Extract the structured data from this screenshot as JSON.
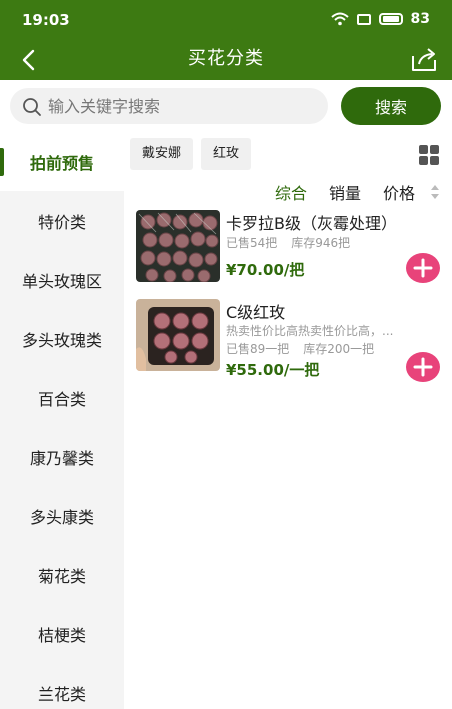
{
  "status_bar": {
    "time": "19:03",
    "battery": "83"
  },
  "nav": {
    "title": "买花分类"
  },
  "search": {
    "placeholder": "输入关键字搜索",
    "button": "搜索"
  },
  "sidebar": {
    "items": [
      {
        "label": "拍前预售",
        "active": true
      },
      {
        "label": "特价类"
      },
      {
        "label": "单头玫瑰区"
      },
      {
        "label": "多头玫瑰类"
      },
      {
        "label": "百合类"
      },
      {
        "label": "康乃馨类"
      },
      {
        "label": "多头康类"
      },
      {
        "label": "菊花类"
      },
      {
        "label": "桔梗类"
      },
      {
        "label": "兰花类"
      }
    ]
  },
  "tags": [
    "戴安娜",
    "红玫"
  ],
  "sort": {
    "items": [
      "综合",
      "销量",
      "价格"
    ],
    "active": "综合"
  },
  "products": [
    {
      "name": "卡罗拉B级（灰霉处理）",
      "desc": "",
      "sold": "已售54把",
      "stock": "库存946把",
      "price": "¥70.00/把"
    },
    {
      "name": "C级红玫",
      "desc": "热卖性价比高热卖性价比高，...",
      "sold": "已售89一把",
      "stock": "库存200一把",
      "price": "¥55.00/一把"
    }
  ],
  "colors": {
    "brand": "#3d7a12",
    "accent_green": "#2f6a0c",
    "add_button": "#e8437a"
  }
}
